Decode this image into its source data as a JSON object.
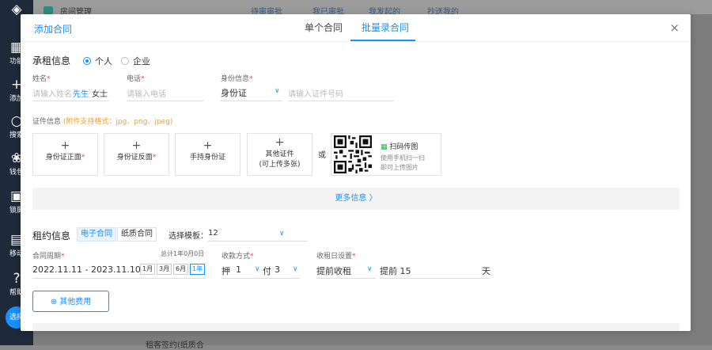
{
  "background": {
    "app_title": "房间管理",
    "tabs": [
      "待审审批",
      "我已审批",
      "我发起的",
      "抄送我的"
    ],
    "sidebar": [
      "功能",
      "添加",
      "搜索",
      "钱包",
      "锁屏",
      "移动",
      "帮助"
    ],
    "avatar": "选择",
    "row_text": "租客签约(纸质合"
  },
  "modal": {
    "title": "添加合同",
    "tabs": [
      "单个合同",
      "批量录合同"
    ],
    "active_tab": 1,
    "close": "×"
  },
  "tenant": {
    "section_title": "承租信息",
    "type_options": [
      "个人",
      "企业"
    ],
    "type_selected": 0,
    "name_label": "姓名",
    "name_placeholder": "请输入姓名",
    "sex_options": [
      "先生",
      "女士"
    ],
    "sex_selected": 0,
    "phone_label": "电话",
    "phone_placeholder": "请输入电话",
    "id_label": "身份信息",
    "id_type": "身份证",
    "id_placeholder": "请输入证件号码",
    "cert_label": "证件信息",
    "cert_hint": "(附件支持格式：jpg、png、jpeg)",
    "uploads": [
      {
        "label": "身份证正面",
        "required": true,
        "sub": ""
      },
      {
        "label": "身份证反面",
        "required": true,
        "sub": ""
      },
      {
        "label": "手持身份证",
        "required": false,
        "sub": ""
      },
      {
        "label": "其他证件",
        "required": false,
        "sub": "(可上传多张)"
      }
    ],
    "or_text": "或",
    "qr_title": "扫码传图",
    "qr_line1": "使用手机扫一扫",
    "qr_line2": "即可上传图片",
    "more_info": "更多信息 〉"
  },
  "lease": {
    "section_title": "租约信息",
    "contract_types": [
      "电子合同",
      "纸质合同"
    ],
    "contract_type_selected": 0,
    "template_label": "选择模板：",
    "template_value": "12",
    "period_label": "合同周期",
    "period_total": "总计1年0月0日",
    "period_value": "2022.11.11 - 2023.11.10",
    "quick_periods": [
      "1月",
      "3月",
      "6月",
      "1年"
    ],
    "quick_selected": 3,
    "pay_label": "收款方式",
    "deposit_prefix": "押",
    "deposit_value": "1",
    "pay_prefix": "付",
    "pay_value": "3",
    "collect_label": "收租日设置",
    "collect_mode": "提前收租",
    "collect_days_text": "提前 15",
    "collect_unit": "天",
    "other_fees_button": "其他费用"
  },
  "colors": {
    "accent": "#1890ff",
    "required": "#e84a4a",
    "hint": "#f0a030"
  }
}
